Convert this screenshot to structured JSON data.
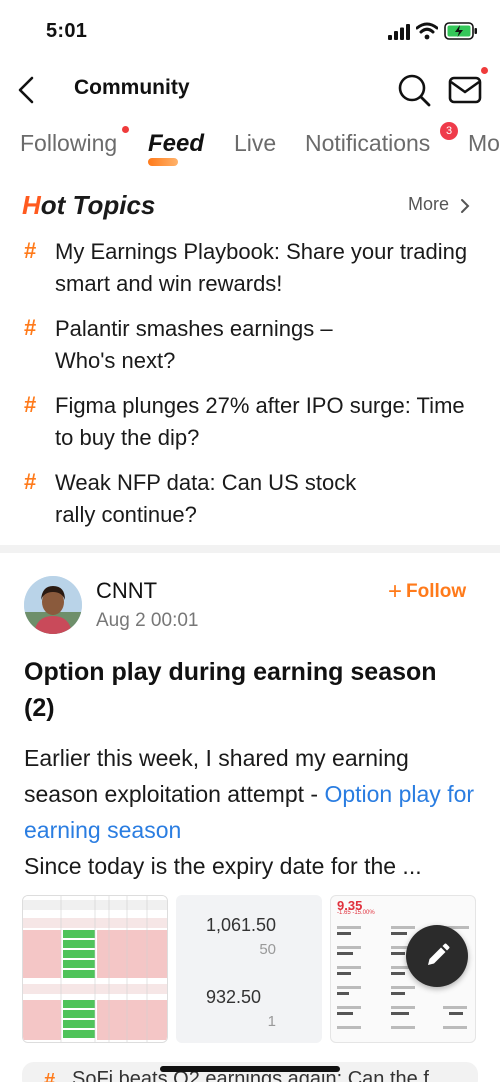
{
  "status_bar": {
    "time": "5:01"
  },
  "nav": {
    "title": "Community"
  },
  "tabs": {
    "following": "Following",
    "feed": "Feed",
    "live": "Live",
    "notifications": "Notifications",
    "notifications_badge": "3",
    "more": "Mo"
  },
  "hot_topics": {
    "title_h": "H",
    "title_rest": "ot Topics",
    "more": "More",
    "items": [
      {
        "hash": "#",
        "text": "My Earnings Playbook: Share your trading smart and win rewards!"
      },
      {
        "hash": "#",
        "text": "Palantir smashes earnings – Who's next?"
      },
      {
        "hash": "#",
        "text": "Figma plunges 27% after IPO surge: Time to buy the dip?"
      },
      {
        "hash": "#",
        "text": "Weak NFP data: Can US stock rally continue?"
      }
    ]
  },
  "post": {
    "author": "CNNT",
    "date": "Aug 2 00:01",
    "follow": "Follow",
    "title": "Option play during earning season (2)",
    "body_prefix": "Earlier this week,  I shared my earning season exploitation attempt - ",
    "body_link": "Option play for earning season",
    "body_suffix": "Since today is the expiry date for the ...",
    "image2": {
      "value1": "1,061.50",
      "sub1": "50",
      "value2": "932.50",
      "sub2": "1"
    },
    "image3": {
      "price": "9.35",
      "change": "-1.65 -15.00%"
    }
  },
  "next_topic": {
    "hash": "#",
    "text": "SoFi beats Q2 earnings again: Can the f"
  },
  "colors": {
    "accent": "#ff7a1a",
    "link": "#2a7de1",
    "badge": "#ef3b4a"
  }
}
